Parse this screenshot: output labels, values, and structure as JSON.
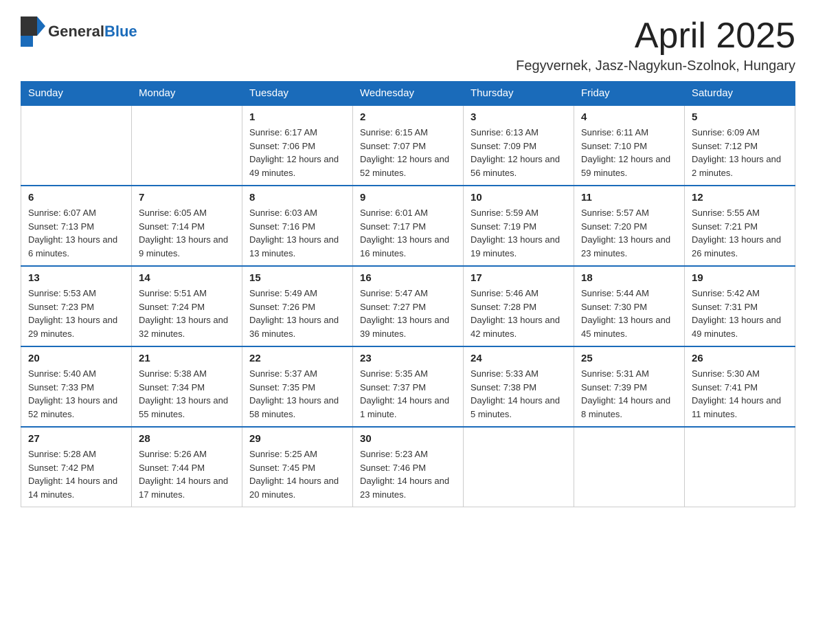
{
  "header": {
    "logo": {
      "text_general": "General",
      "text_blue": "Blue"
    },
    "month_title": "April 2025",
    "location": "Fegyvernek, Jasz-Nagykun-Szolnok, Hungary"
  },
  "days_of_week": [
    "Sunday",
    "Monday",
    "Tuesday",
    "Wednesday",
    "Thursday",
    "Friday",
    "Saturday"
  ],
  "weeks": [
    [
      {
        "day": "",
        "sunrise": "",
        "sunset": "",
        "daylight": ""
      },
      {
        "day": "",
        "sunrise": "",
        "sunset": "",
        "daylight": ""
      },
      {
        "day": "1",
        "sunrise": "Sunrise: 6:17 AM",
        "sunset": "Sunset: 7:06 PM",
        "daylight": "Daylight: 12 hours and 49 minutes."
      },
      {
        "day": "2",
        "sunrise": "Sunrise: 6:15 AM",
        "sunset": "Sunset: 7:07 PM",
        "daylight": "Daylight: 12 hours and 52 minutes."
      },
      {
        "day": "3",
        "sunrise": "Sunrise: 6:13 AM",
        "sunset": "Sunset: 7:09 PM",
        "daylight": "Daylight: 12 hours and 56 minutes."
      },
      {
        "day": "4",
        "sunrise": "Sunrise: 6:11 AM",
        "sunset": "Sunset: 7:10 PM",
        "daylight": "Daylight: 12 hours and 59 minutes."
      },
      {
        "day": "5",
        "sunrise": "Sunrise: 6:09 AM",
        "sunset": "Sunset: 7:12 PM",
        "daylight": "Daylight: 13 hours and 2 minutes."
      }
    ],
    [
      {
        "day": "6",
        "sunrise": "Sunrise: 6:07 AM",
        "sunset": "Sunset: 7:13 PM",
        "daylight": "Daylight: 13 hours and 6 minutes."
      },
      {
        "day": "7",
        "sunrise": "Sunrise: 6:05 AM",
        "sunset": "Sunset: 7:14 PM",
        "daylight": "Daylight: 13 hours and 9 minutes."
      },
      {
        "day": "8",
        "sunrise": "Sunrise: 6:03 AM",
        "sunset": "Sunset: 7:16 PM",
        "daylight": "Daylight: 13 hours and 13 minutes."
      },
      {
        "day": "9",
        "sunrise": "Sunrise: 6:01 AM",
        "sunset": "Sunset: 7:17 PM",
        "daylight": "Daylight: 13 hours and 16 minutes."
      },
      {
        "day": "10",
        "sunrise": "Sunrise: 5:59 AM",
        "sunset": "Sunset: 7:19 PM",
        "daylight": "Daylight: 13 hours and 19 minutes."
      },
      {
        "day": "11",
        "sunrise": "Sunrise: 5:57 AM",
        "sunset": "Sunset: 7:20 PM",
        "daylight": "Daylight: 13 hours and 23 minutes."
      },
      {
        "day": "12",
        "sunrise": "Sunrise: 5:55 AM",
        "sunset": "Sunset: 7:21 PM",
        "daylight": "Daylight: 13 hours and 26 minutes."
      }
    ],
    [
      {
        "day": "13",
        "sunrise": "Sunrise: 5:53 AM",
        "sunset": "Sunset: 7:23 PM",
        "daylight": "Daylight: 13 hours and 29 minutes."
      },
      {
        "day": "14",
        "sunrise": "Sunrise: 5:51 AM",
        "sunset": "Sunset: 7:24 PM",
        "daylight": "Daylight: 13 hours and 32 minutes."
      },
      {
        "day": "15",
        "sunrise": "Sunrise: 5:49 AM",
        "sunset": "Sunset: 7:26 PM",
        "daylight": "Daylight: 13 hours and 36 minutes."
      },
      {
        "day": "16",
        "sunrise": "Sunrise: 5:47 AM",
        "sunset": "Sunset: 7:27 PM",
        "daylight": "Daylight: 13 hours and 39 minutes."
      },
      {
        "day": "17",
        "sunrise": "Sunrise: 5:46 AM",
        "sunset": "Sunset: 7:28 PM",
        "daylight": "Daylight: 13 hours and 42 minutes."
      },
      {
        "day": "18",
        "sunrise": "Sunrise: 5:44 AM",
        "sunset": "Sunset: 7:30 PM",
        "daylight": "Daylight: 13 hours and 45 minutes."
      },
      {
        "day": "19",
        "sunrise": "Sunrise: 5:42 AM",
        "sunset": "Sunset: 7:31 PM",
        "daylight": "Daylight: 13 hours and 49 minutes."
      }
    ],
    [
      {
        "day": "20",
        "sunrise": "Sunrise: 5:40 AM",
        "sunset": "Sunset: 7:33 PM",
        "daylight": "Daylight: 13 hours and 52 minutes."
      },
      {
        "day": "21",
        "sunrise": "Sunrise: 5:38 AM",
        "sunset": "Sunset: 7:34 PM",
        "daylight": "Daylight: 13 hours and 55 minutes."
      },
      {
        "day": "22",
        "sunrise": "Sunrise: 5:37 AM",
        "sunset": "Sunset: 7:35 PM",
        "daylight": "Daylight: 13 hours and 58 minutes."
      },
      {
        "day": "23",
        "sunrise": "Sunrise: 5:35 AM",
        "sunset": "Sunset: 7:37 PM",
        "daylight": "Daylight: 14 hours and 1 minute."
      },
      {
        "day": "24",
        "sunrise": "Sunrise: 5:33 AM",
        "sunset": "Sunset: 7:38 PM",
        "daylight": "Daylight: 14 hours and 5 minutes."
      },
      {
        "day": "25",
        "sunrise": "Sunrise: 5:31 AM",
        "sunset": "Sunset: 7:39 PM",
        "daylight": "Daylight: 14 hours and 8 minutes."
      },
      {
        "day": "26",
        "sunrise": "Sunrise: 5:30 AM",
        "sunset": "Sunset: 7:41 PM",
        "daylight": "Daylight: 14 hours and 11 minutes."
      }
    ],
    [
      {
        "day": "27",
        "sunrise": "Sunrise: 5:28 AM",
        "sunset": "Sunset: 7:42 PM",
        "daylight": "Daylight: 14 hours and 14 minutes."
      },
      {
        "day": "28",
        "sunrise": "Sunrise: 5:26 AM",
        "sunset": "Sunset: 7:44 PM",
        "daylight": "Daylight: 14 hours and 17 minutes."
      },
      {
        "day": "29",
        "sunrise": "Sunrise: 5:25 AM",
        "sunset": "Sunset: 7:45 PM",
        "daylight": "Daylight: 14 hours and 20 minutes."
      },
      {
        "day": "30",
        "sunrise": "Sunrise: 5:23 AM",
        "sunset": "Sunset: 7:46 PM",
        "daylight": "Daylight: 14 hours and 23 minutes."
      },
      {
        "day": "",
        "sunrise": "",
        "sunset": "",
        "daylight": ""
      },
      {
        "day": "",
        "sunrise": "",
        "sunset": "",
        "daylight": ""
      },
      {
        "day": "",
        "sunrise": "",
        "sunset": "",
        "daylight": ""
      }
    ]
  ]
}
